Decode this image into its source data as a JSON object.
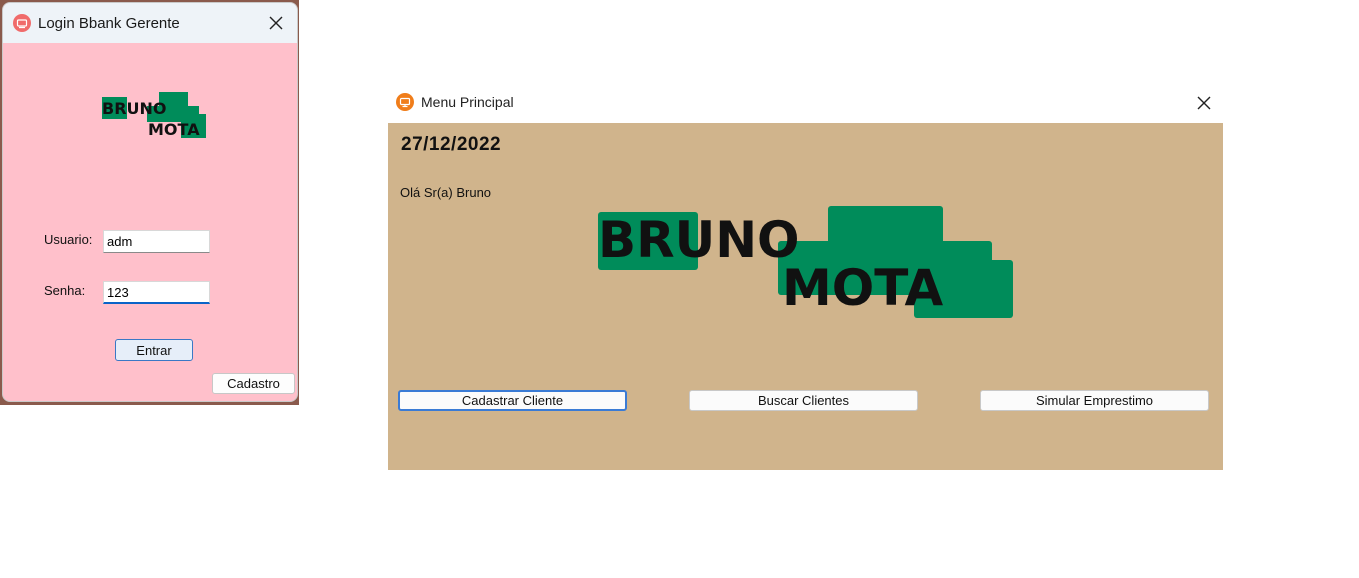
{
  "login_window": {
    "title": "Login Bbank Gerente",
    "logo": {
      "line1": "BRUNO",
      "line2": "MOTA"
    },
    "usuario_label": "Usuario:",
    "usuario_value": "adm",
    "senha_label": "Senha:",
    "senha_value": "123",
    "entrar_label": "Entrar",
    "cadastro_label": "Cadastro"
  },
  "menu_window": {
    "title": "Menu Principal",
    "date": "27/12/2022",
    "greeting": "Olá Sr(a) Bruno",
    "logo": {
      "line1": "BRUNO",
      "line2": "MOTA"
    },
    "buttons": {
      "cadastrar": "Cadastrar Cliente",
      "buscar": "Buscar Clientes",
      "simular": "Simular Emprestimo"
    }
  },
  "colors": {
    "login_bg": "#ffc0cb",
    "menu_bg": "#d0b48c",
    "logo_green": "#008c5a",
    "focus_blue": "#0a64c8"
  }
}
